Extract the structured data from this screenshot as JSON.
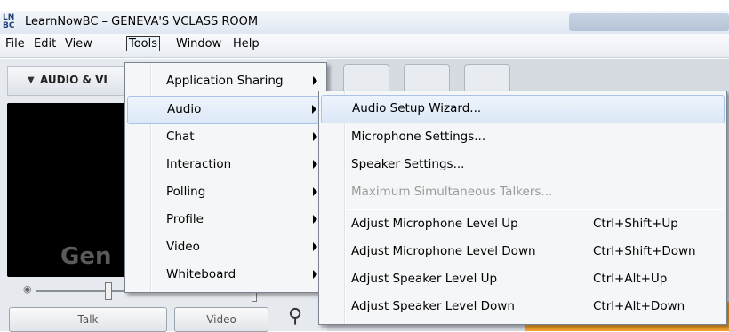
{
  "window": {
    "logo_text": "LN BC",
    "title": "LearnNowBC – GENEVA'S VCLASS ROOM"
  },
  "menubar": {
    "items": [
      "File",
      "Edit",
      "View",
      "Tools",
      "Window",
      "Help"
    ],
    "active": "Tools"
  },
  "left_panel": {
    "header": "AUDIO & VI",
    "video_name": "Gen",
    "buttons": {
      "talk": "Talk",
      "video": "Video"
    }
  },
  "tools_menu": {
    "items": [
      {
        "label": "Application Sharing",
        "submenu": true
      },
      {
        "label": "Audio",
        "submenu": true,
        "highlighted": true
      },
      {
        "label": "Chat",
        "submenu": true
      },
      {
        "label": "Interaction",
        "submenu": true
      },
      {
        "label": "Polling",
        "submenu": true
      },
      {
        "label": "Profile",
        "submenu": true
      },
      {
        "label": "Video",
        "submenu": true
      },
      {
        "label": "Whiteboard",
        "submenu": true
      }
    ]
  },
  "audio_submenu": {
    "items": [
      {
        "label": "Audio Setup Wizard...",
        "shortcut": "",
        "highlighted": true
      },
      {
        "label": "Microphone Settings...",
        "shortcut": ""
      },
      {
        "label": "Speaker Settings...",
        "shortcut": ""
      },
      {
        "label": "Maximum Simultaneous Talkers...",
        "shortcut": "",
        "disabled": true
      },
      {
        "label": "Adjust Microphone Level Up",
        "shortcut": "Ctrl+Shift+Up"
      },
      {
        "label": "Adjust Microphone Level Down",
        "shortcut": "Ctrl+Shift+Down"
      },
      {
        "label": "Adjust Speaker Level Up",
        "shortcut": "Ctrl+Alt+Up"
      },
      {
        "label": "Adjust Speaker Level Down",
        "shortcut": "Ctrl+Alt+Down"
      }
    ]
  },
  "colors": {
    "highlight": "#dce8f7",
    "accent_orange": "#f4a22a"
  }
}
